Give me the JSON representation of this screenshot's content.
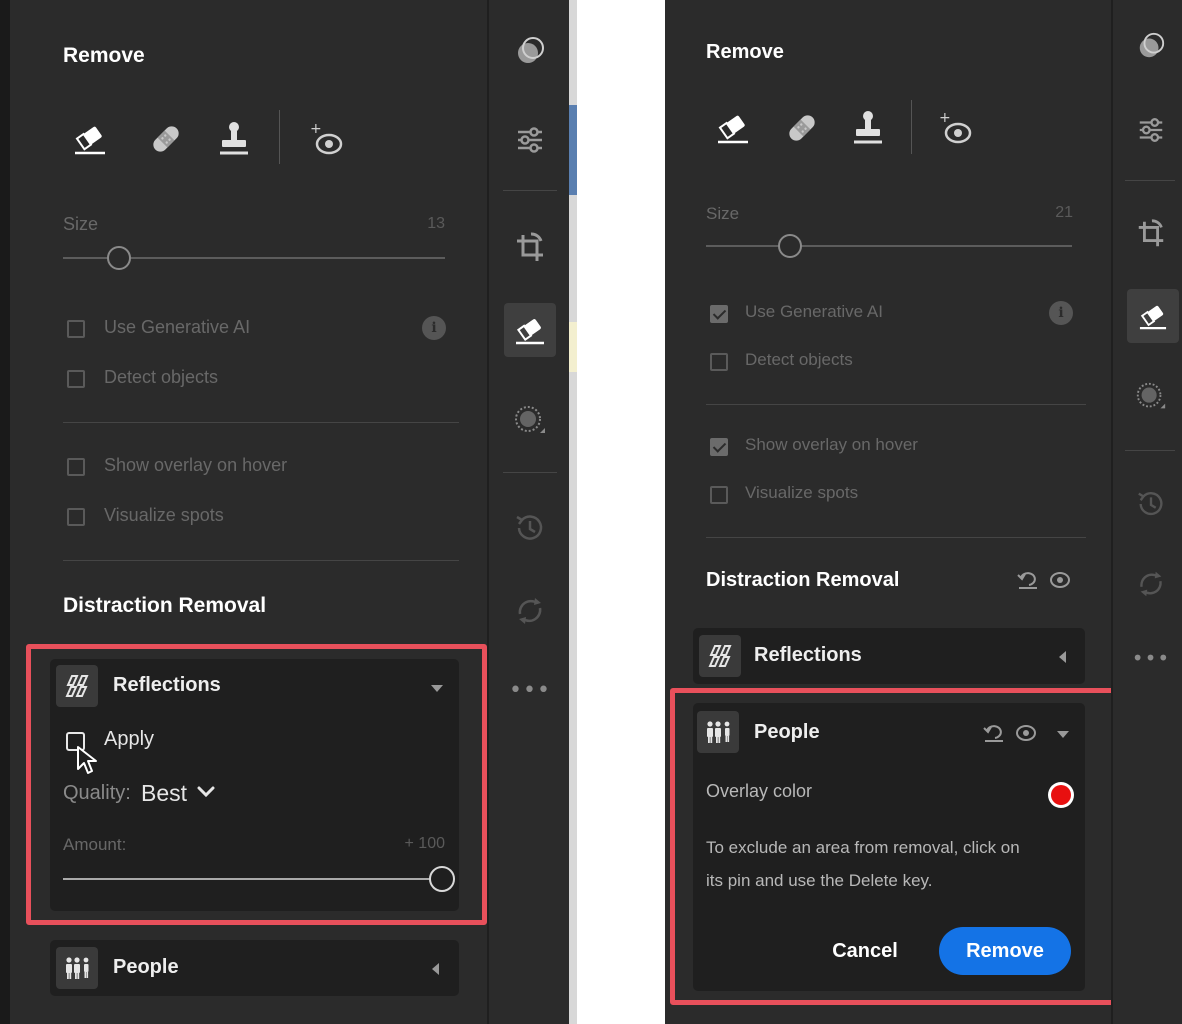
{
  "left": {
    "remove_title": "Remove",
    "tools": [
      {
        "icon": "eraser-icon"
      },
      {
        "icon": "bandage-icon"
      },
      {
        "icon": "stamp-icon"
      },
      {
        "icon": "red-eye-icon"
      }
    ],
    "size_label": "Size",
    "size_value": "13",
    "size_slider_fraction": 0.15,
    "gen_ai_label": "Use Generative AI",
    "gen_ai_checked": false,
    "detect_label": "Detect objects",
    "detect_checked": false,
    "overlay_label": "Show overlay on hover",
    "overlay_checked": false,
    "visualize_label": "Visualize spots",
    "visualize_checked": false,
    "distraction_title": "Distraction Removal",
    "reflections": {
      "title": "Reflections",
      "apply_label": "Apply",
      "apply_checked": false,
      "quality_label": "Quality:",
      "quality_value": "Best",
      "amount_label": "Amount:",
      "amount_value": "+ 100",
      "amount_fraction": 1.0
    },
    "people_title": "People"
  },
  "right": {
    "remove_title": "Remove",
    "size_label": "Size",
    "size_value": "21",
    "size_slider_fraction": 0.24,
    "gen_ai_label": "Use Generative AI",
    "gen_ai_checked": true,
    "detect_label": "Detect objects",
    "detect_checked": false,
    "overlay_label": "Show overlay on hover",
    "overlay_checked": true,
    "visualize_label": "Visualize spots",
    "visualize_checked": false,
    "distraction_title": "Distraction Removal",
    "reflections_title": "Reflections",
    "people": {
      "title": "People",
      "overlay_color_label": "Overlay color",
      "overlay_color": "#e81010",
      "help_line1": "To exclude an area from removal, click on",
      "help_line2": "its pin and use the Delete key.",
      "cancel_label": "Cancel",
      "remove_label": "Remove"
    }
  },
  "colors": {
    "panel_bg": "#2b2b2b",
    "card_bg": "#1f1f1f",
    "accent_blue": "#1473e6",
    "highlight_red": "#e8505b"
  },
  "strip_icons": [
    "masking-icon",
    "adjust-sliders-icon",
    "crop-rotate-icon",
    "eraser-icon",
    "dot-grid-icon",
    "history-icon",
    "sync-icon",
    "more-icon"
  ]
}
